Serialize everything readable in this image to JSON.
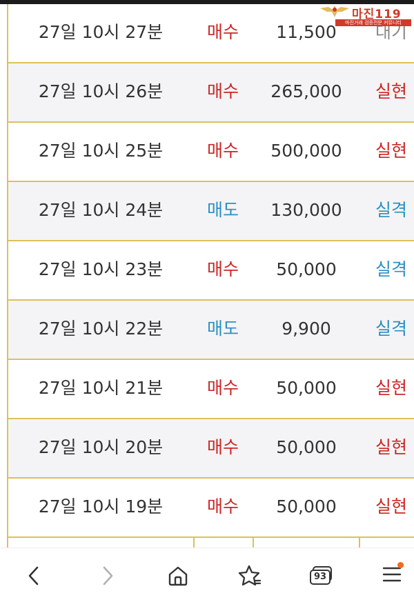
{
  "watermark": {
    "title": "마진119",
    "subtitle": "마진거래 검증전문 커뮤니티"
  },
  "rows": [
    {
      "time": "27일 10시 27분",
      "type": "매수",
      "amount": "11,500",
      "status": "대기"
    },
    {
      "time": "27일 10시 26분",
      "type": "매수",
      "amount": "265,000",
      "status": "실현"
    },
    {
      "time": "27일 10시 25분",
      "type": "매수",
      "amount": "500,000",
      "status": "실현"
    },
    {
      "time": "27일 10시 24분",
      "type": "매도",
      "amount": "130,000",
      "status": "실격"
    },
    {
      "time": "27일 10시 23분",
      "type": "매수",
      "amount": "50,000",
      "status": "실격"
    },
    {
      "time": "27일 10시 22분",
      "type": "매도",
      "amount": "9,900",
      "status": "실격"
    },
    {
      "time": "27일 10시 21분",
      "type": "매수",
      "amount": "50,000",
      "status": "실현"
    },
    {
      "time": "27일 10시 20분",
      "type": "매수",
      "amount": "50,000",
      "status": "실현"
    },
    {
      "time": "27일 10시 19분",
      "type": "매수",
      "amount": "50,000",
      "status": "실현"
    }
  ],
  "colors": {
    "buy": "#cc2525",
    "sell": "#2b8fc0",
    "realized": "#cc2525",
    "failed": "#2b8fc0",
    "pending": "#8a8a8a",
    "grid": "#dcc15a"
  },
  "nav": {
    "back_icon": "chevron-left-icon",
    "forward_icon": "chevron-right-icon",
    "home_icon": "home-icon",
    "bookmark_icon": "star-bookmark-icon",
    "tabs_icon": "tabs-icon",
    "tabs_count": "93",
    "menu_icon": "menu-icon"
  }
}
